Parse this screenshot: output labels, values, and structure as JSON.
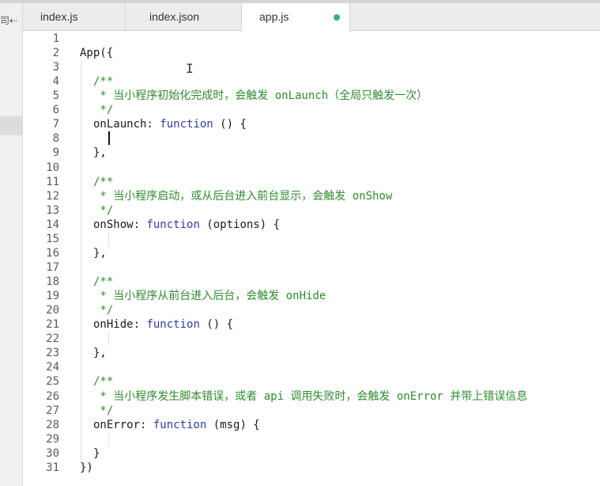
{
  "sidebar": {
    "glyph": "司⇠"
  },
  "tabs": [
    {
      "label": "index.js",
      "active": false
    },
    {
      "label": "index.json",
      "active": false
    },
    {
      "label": "app.js",
      "active": true,
      "modified_dot_color": "#3cb371"
    }
  ],
  "colors": {
    "comment": "#2e8b2e",
    "keyword": "#2f3ca8",
    "identifier": "#1a1a1a",
    "line_number": "#5a5a5a"
  },
  "cursor_icon": "text-ibeam-icon",
  "code": [
    {
      "n": "1",
      "indent": 0,
      "t": []
    },
    {
      "n": "2",
      "indent": 0,
      "t": [
        {
          "c": "id",
          "s": "App({"
        }
      ]
    },
    {
      "n": "3",
      "indent": 0,
      "t": []
    },
    {
      "n": "4",
      "indent": 1,
      "t": [
        {
          "c": "cm",
          "s": "/**"
        }
      ]
    },
    {
      "n": "5",
      "indent": 1,
      "t": [
        {
          "c": "cm",
          "s": " * 当小程序初始化完成时，会触发 onLaunch（全局只触发一次）"
        }
      ]
    },
    {
      "n": "6",
      "indent": 1,
      "t": [
        {
          "c": "cm",
          "s": " */"
        }
      ]
    },
    {
      "n": "7",
      "indent": 1,
      "t": [
        {
          "c": "id",
          "s": "onLaunch: "
        },
        {
          "c": "kw",
          "s": "function"
        },
        {
          "c": "id",
          "s": " () {"
        }
      ]
    },
    {
      "n": "8",
      "indent": 2,
      "t": []
    },
    {
      "n": "9",
      "indent": 1,
      "t": [
        {
          "c": "id",
          "s": "},"
        }
      ]
    },
    {
      "n": "10",
      "indent": 1,
      "t": []
    },
    {
      "n": "11",
      "indent": 1,
      "t": [
        {
          "c": "cm",
          "s": "/**"
        }
      ]
    },
    {
      "n": "12",
      "indent": 1,
      "t": [
        {
          "c": "cm",
          "s": " * 当小程序启动，或从后台进入前台显示，会触发 onShow"
        }
      ]
    },
    {
      "n": "13",
      "indent": 1,
      "t": [
        {
          "c": "cm",
          "s": " */"
        }
      ]
    },
    {
      "n": "14",
      "indent": 1,
      "t": [
        {
          "c": "id",
          "s": "onShow: "
        },
        {
          "c": "kw",
          "s": "function"
        },
        {
          "c": "id",
          "s": " (options) {"
        }
      ]
    },
    {
      "n": "15",
      "indent": 2,
      "t": []
    },
    {
      "n": "16",
      "indent": 1,
      "t": [
        {
          "c": "id",
          "s": "},"
        }
      ]
    },
    {
      "n": "17",
      "indent": 1,
      "t": []
    },
    {
      "n": "18",
      "indent": 1,
      "t": [
        {
          "c": "cm",
          "s": "/**"
        }
      ]
    },
    {
      "n": "19",
      "indent": 1,
      "t": [
        {
          "c": "cm",
          "s": " * 当小程序从前台进入后台，会触发 onHide"
        }
      ]
    },
    {
      "n": "20",
      "indent": 1,
      "t": [
        {
          "c": "cm",
          "s": " */"
        }
      ]
    },
    {
      "n": "21",
      "indent": 1,
      "t": [
        {
          "c": "id",
          "s": "onHide: "
        },
        {
          "c": "kw",
          "s": "function"
        },
        {
          "c": "id",
          "s": " () {"
        }
      ]
    },
    {
      "n": "22",
      "indent": 2,
      "t": []
    },
    {
      "n": "23",
      "indent": 1,
      "t": [
        {
          "c": "id",
          "s": "},"
        }
      ]
    },
    {
      "n": "24",
      "indent": 1,
      "t": []
    },
    {
      "n": "25",
      "indent": 1,
      "t": [
        {
          "c": "cm",
          "s": "/**"
        }
      ]
    },
    {
      "n": "26",
      "indent": 1,
      "t": [
        {
          "c": "cm",
          "s": " * 当小程序发生脚本错误，或者 api 调用失败时，会触发 onError 并带上错误信息"
        }
      ]
    },
    {
      "n": "27",
      "indent": 1,
      "t": [
        {
          "c": "cm",
          "s": " */"
        }
      ]
    },
    {
      "n": "28",
      "indent": 1,
      "t": [
        {
          "c": "id",
          "s": "onError: "
        },
        {
          "c": "kw",
          "s": "function"
        },
        {
          "c": "id",
          "s": " (msg) {"
        }
      ]
    },
    {
      "n": "29",
      "indent": 2,
      "t": []
    },
    {
      "n": "30",
      "indent": 1,
      "t": [
        {
          "c": "id",
          "s": "}"
        }
      ]
    },
    {
      "n": "31",
      "indent": 0,
      "t": [
        {
          "c": "id",
          "s": "})"
        }
      ]
    }
  ]
}
